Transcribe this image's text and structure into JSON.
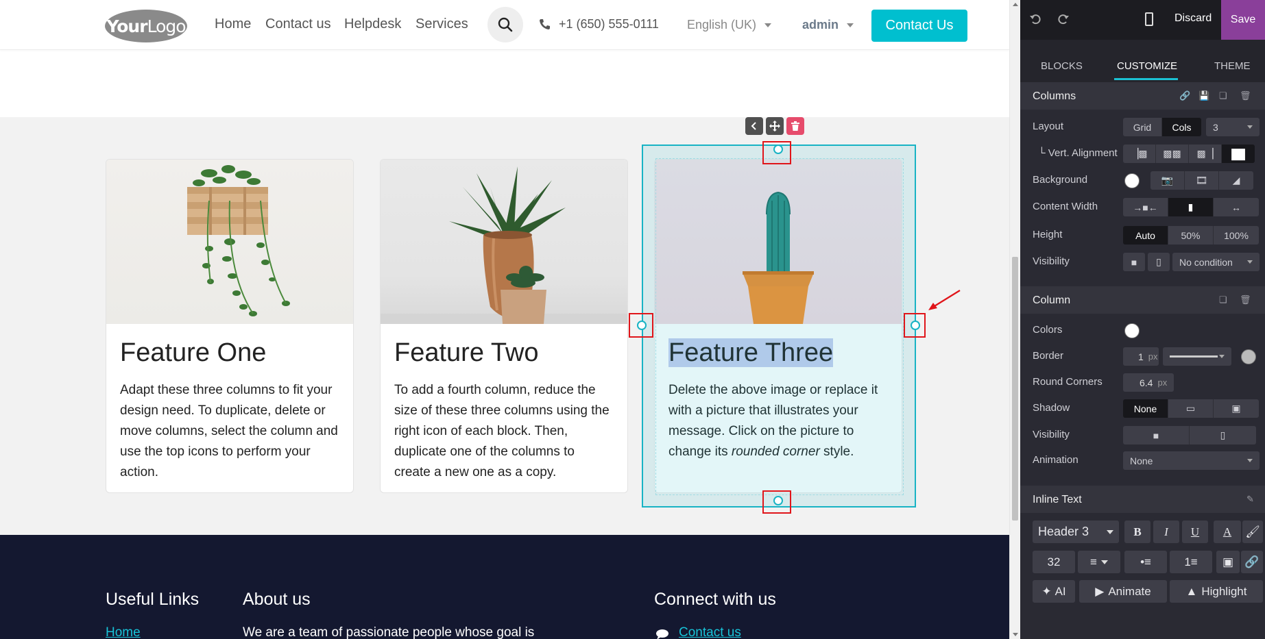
{
  "header": {
    "logo_text_bold": "Your",
    "logo_text_light": "Logo",
    "nav": [
      "Home",
      "Contact us",
      "Helpdesk",
      "Services"
    ],
    "phone": "+1 (650) 555-0111",
    "language": "English (UK)",
    "user": "admin",
    "cta": "Contact Us"
  },
  "features": [
    {
      "title": "Feature One",
      "text": "Adapt these three columns to fit your design need. To duplicate, delete or move columns, select the column and use the top icons to perform your action."
    },
    {
      "title": "Feature Two",
      "text": "To add a fourth column, reduce the size of these three columns using the right icon of each block. Then, duplicate one of the columns to create a new one as a copy."
    },
    {
      "title": "Feature Three",
      "text_before": "Delete the above image or replace it with a picture that illustrates your message. Click on the picture to change its ",
      "text_italic": "rounded corner",
      "text_after": " style."
    }
  ],
  "footer": {
    "col1_title": "Useful Links",
    "col1_link": "Home",
    "col2_title": "About us",
    "col2_text": "We are a team of passionate people whose goal is",
    "col3_title": "Connect with us",
    "col3_link": "Contact us"
  },
  "panel": {
    "discard": "Discard",
    "save": "Save",
    "tabs": [
      "BLOCKS",
      "CUSTOMIZE",
      "THEME"
    ],
    "columns": {
      "title": "Columns",
      "layout_label": "Layout",
      "layout_options": [
        "Grid",
        "Cols"
      ],
      "layout_count": "3",
      "vert_alignment_label": "└ Vert. Alignment",
      "background_label": "Background",
      "content_width_label": "Content Width",
      "height_label": "Height",
      "height_options": [
        "Auto",
        "50%",
        "100%"
      ],
      "visibility_label": "Visibility",
      "visibility_condition": "No condition"
    },
    "column": {
      "title": "Column",
      "colors_label": "Colors",
      "border_label": "Border",
      "border_value": "1",
      "border_unit": "px",
      "round_corners_label": "Round Corners",
      "round_corners_value": "6.4",
      "round_corners_unit": "px",
      "shadow_label": "Shadow",
      "shadow_value": "None",
      "visibility_label": "Visibility",
      "animation_label": "Animation",
      "animation_value": "None"
    },
    "inline_text": {
      "title": "Inline Text",
      "style": "Header 3",
      "bold": "B",
      "italic": "I",
      "underline": "U",
      "font_color": "A",
      "font_size": "32",
      "ai": "AI",
      "animate": "Animate",
      "highlight": "Highlight"
    }
  }
}
